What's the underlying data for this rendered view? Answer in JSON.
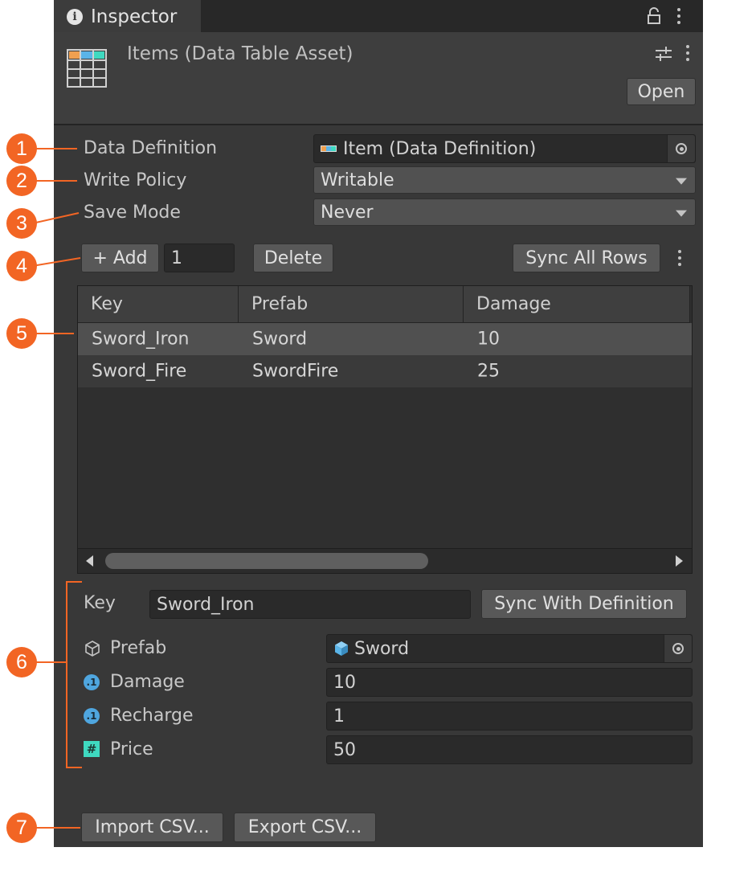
{
  "window": {
    "tab_title": "Inspector",
    "asset_title": "Items (Data Table Asset)",
    "open_button": "Open"
  },
  "properties": {
    "data_definition": {
      "label": "Data Definition",
      "value": "Item (Data Definition)"
    },
    "write_policy": {
      "label": "Write Policy",
      "value": "Writable"
    },
    "save_mode": {
      "label": "Save Mode",
      "value": "Never"
    }
  },
  "toolbar": {
    "add_label": "+ Add",
    "add_count": "1",
    "delete_label": "Delete",
    "sync_all_label": "Sync All Rows"
  },
  "table": {
    "columns": [
      "Key",
      "Prefab",
      "Damage"
    ],
    "rows": [
      {
        "key": "Sword_Iron",
        "prefab": "Sword",
        "damage": "10"
      },
      {
        "key": "Sword_Fire",
        "prefab": "SwordFire",
        "damage": "25"
      }
    ]
  },
  "detail": {
    "key_label": "Key",
    "key_value": "Sword_Iron",
    "sync_definition_label": "Sync With Definition",
    "fields": [
      {
        "label": "Prefab",
        "value": "Sword",
        "icon": "cube-outline-icon"
      },
      {
        "label": "Damage",
        "value": "10",
        "icon": "int-type-icon"
      },
      {
        "label": "Recharge",
        "value": "1",
        "icon": "int-type-icon"
      },
      {
        "label": "Price",
        "value": "50",
        "icon": "hash-icon"
      }
    ]
  },
  "footer": {
    "import_label": "Import CSV...",
    "export_label": "Export CSV..."
  },
  "callouts": [
    "1",
    "2",
    "3",
    "4",
    "5",
    "6",
    "7"
  ],
  "colors": {
    "callout": "#f26524",
    "panel": "#383838",
    "int_icon": "#4fa6df",
    "hash_icon": "#3fd9c0",
    "prefab_icon": "#5ab4e8"
  }
}
